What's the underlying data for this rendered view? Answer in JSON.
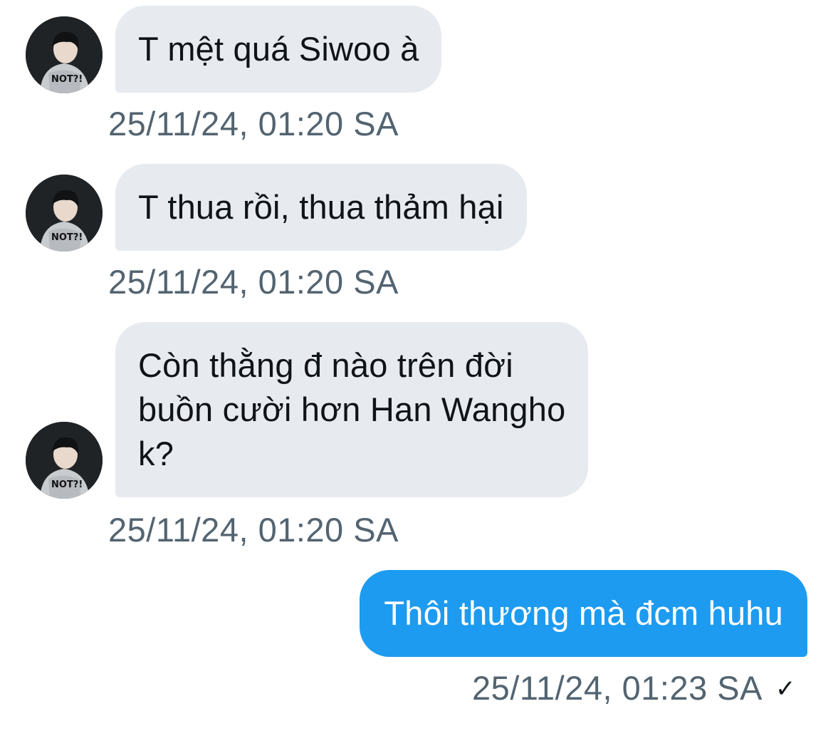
{
  "messages": [
    {
      "direction": "in",
      "lines": [
        "T mệt quá Siwoo à"
      ],
      "timestamp": "25/11/24, 01:20 SA"
    },
    {
      "direction": "in",
      "lines": [
        "T thua rồi, thua thảm hại"
      ],
      "timestamp": "25/11/24, 01:20 SA"
    },
    {
      "direction": "in",
      "lines": [
        "Còn thằng đ nào trên đời",
        "buồn cười hơn Han Wangho",
        "k?"
      ],
      "timestamp": "25/11/24, 01:20 SA"
    },
    {
      "direction": "out",
      "lines": [
        "Thôi thương mà đcm huhu"
      ],
      "timestamp": "25/11/24, 01:23 SA",
      "status_icon": "check-icon"
    }
  ],
  "avatar": {
    "icon": "user-avatar-photo",
    "hoodie_print": "NOT?!"
  },
  "colors": {
    "incoming_bubble": "#e7ebef",
    "outgoing_bubble": "#1d9bf0",
    "timestamp": "#536471",
    "text": "#0f1419"
  }
}
